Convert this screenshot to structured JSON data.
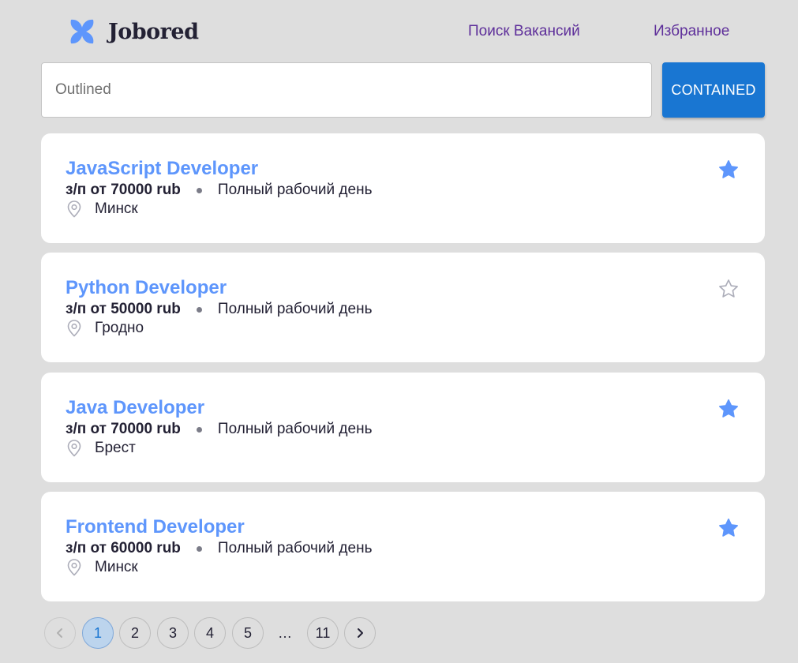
{
  "header": {
    "logo_text": "Jobored",
    "nav": {
      "search": "Поиск Вакансий",
      "favorites": "Избранное"
    }
  },
  "search": {
    "placeholder": "Outlined",
    "value": "",
    "button_label": "CONTAINED"
  },
  "vacancies": [
    {
      "title": "JavaScript Developer",
      "salary": "з/п от 70000 rub",
      "schedule": "Полный рабочий день",
      "location": "Минск",
      "favorite": true
    },
    {
      "title": "Python Developer",
      "salary": "з/п от 50000 rub",
      "schedule": "Полный рабочий день",
      "location": "Гродно",
      "favorite": false
    },
    {
      "title": "Java Developer",
      "salary": "з/п от 70000 rub",
      "schedule": "Полный рабочий день",
      "location": "Брест",
      "favorite": true
    },
    {
      "title": "Frontend Developer",
      "salary": "з/п от 60000 rub",
      "schedule": "Полный рабочий день",
      "location": "Минск",
      "favorite": true
    }
  ],
  "pagination": {
    "pages": [
      "1",
      "2",
      "3",
      "4",
      "5"
    ],
    "ellipsis": "…",
    "last_page": "11",
    "current": "1"
  },
  "colors": {
    "accent": "#5e96fc",
    "button": "#1976d2",
    "nav_link": "#5e2f9a",
    "background": "#dedede"
  },
  "icons": {
    "logo": "logo-icon",
    "location": "location-pin-icon",
    "star_filled": "star-filled-icon",
    "star_outline": "star-outline-icon",
    "prev": "chevron-left-icon",
    "next": "chevron-right-icon"
  }
}
